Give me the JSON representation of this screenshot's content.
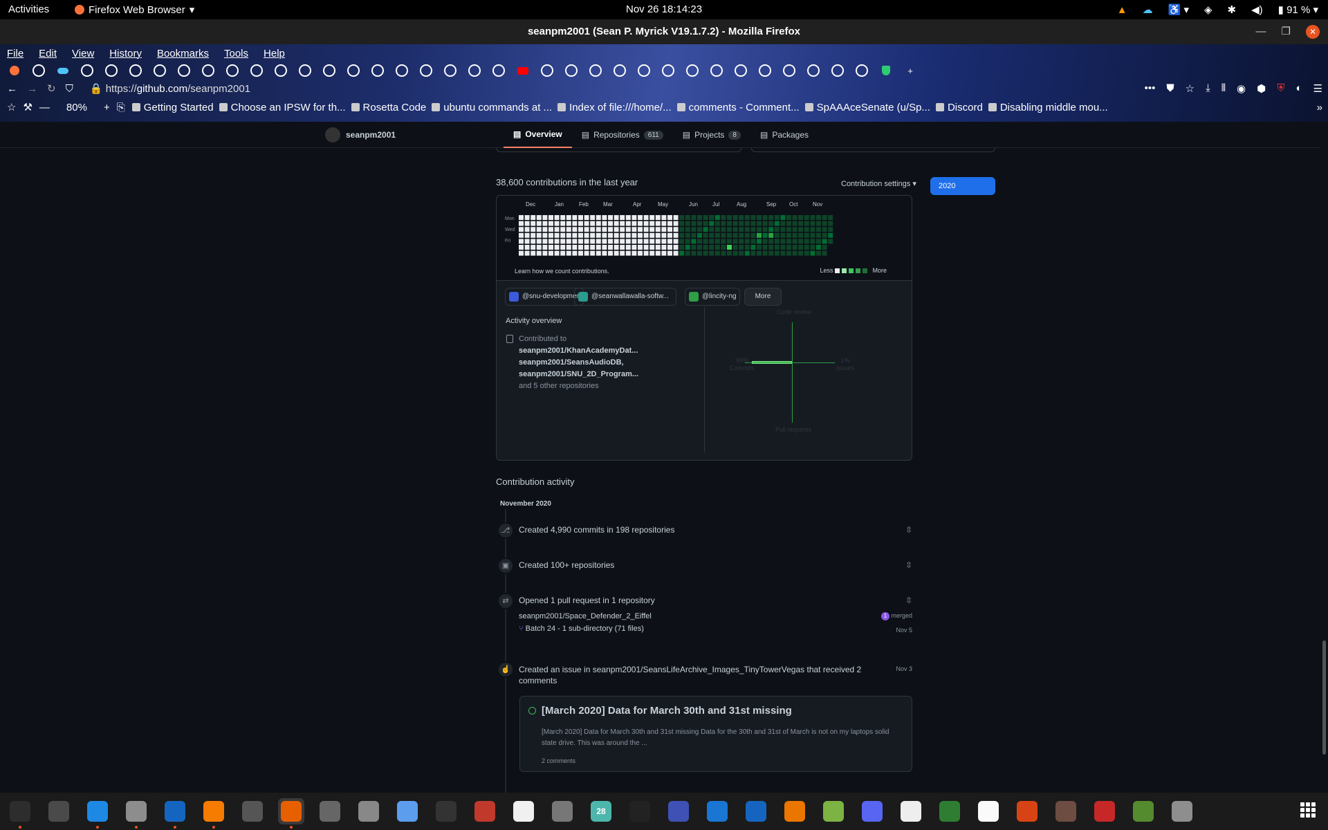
{
  "system": {
    "activities": "Activities",
    "app_name": "Firefox Web Browser",
    "clock": "Nov 26  18:14:23",
    "battery": "91 %"
  },
  "window": {
    "title": "seanpm2001 (Sean P. Myrick V19.1.7.2) - Mozilla Firefox"
  },
  "menu": [
    "File",
    "Edit",
    "View",
    "History",
    "Bookmarks",
    "Tools",
    "Help"
  ],
  "tabs": [
    "ff",
    "gh",
    "cloud",
    "gh",
    "gh",
    "gh",
    "gh",
    "gh",
    "gh",
    "gh",
    "gh",
    "gh",
    "gh",
    "gh",
    "gh",
    "gh",
    "gh",
    "gh",
    "gh",
    "gh",
    "gh",
    "yt",
    "gh",
    "gh",
    "gh",
    "gh",
    "gh",
    "gh",
    "gh",
    "gh",
    "gh",
    "gh",
    "gh",
    "gh",
    "gh",
    "gh",
    "vpn"
  ],
  "url": {
    "prefix": "https://",
    "domain": "github.com",
    "path": "/seanpm2001"
  },
  "zoom": "80%",
  "bookmarks": [
    "Getting Started",
    "Choose an IPSW for th...",
    "Rosetta Code",
    "ubuntu commands at ...",
    "Index of file:///home/...",
    "comments - Comment...",
    "SpAAAceSenate (u/Sp...",
    "Discord",
    "Disabling middle mou..."
  ],
  "profile": {
    "username": "seanpm2001",
    "tabs": [
      {
        "label": "Overview",
        "count": ""
      },
      {
        "label": "Repositories",
        "count": "611"
      },
      {
        "label": "Projects",
        "count": "8"
      },
      {
        "label": "Packages",
        "count": ""
      }
    ]
  },
  "contributions": {
    "heading": "38,600 contributions in the last year",
    "settings": "Contribution settings ▾",
    "year": "2020",
    "months": [
      "Dec",
      "Jan",
      "Feb",
      "Mar",
      "Apr",
      "May",
      "Jun",
      "Jul",
      "Aug",
      "Sep",
      "Oct",
      "Nov"
    ],
    "days": [
      "Mon",
      "Wed",
      "Fri"
    ],
    "learn": "Learn how we count contributions.",
    "less": "Less",
    "more": "More",
    "colors": {
      "empty": "#ebedf0",
      "l1": "#0e4429",
      "l2": "#006d32",
      "l3": "#26a641",
      "l4": "#39d353"
    }
  },
  "orgs": [
    "@snu-development",
    "@seanwallawalla-softw...",
    "@lincity-ng",
    "More"
  ],
  "activity": {
    "title": "Activity overview",
    "contributed_to": "Contributed to",
    "repos": [
      "seanpm2001/KhanAcademyDat...",
      "seanpm2001/SeansAudioDB,",
      "seanpm2001/SNU_2D_Program..."
    ],
    "others": "and 5 other repositories",
    "axes": {
      "code_review": "Code review",
      "commits_pct": "99%",
      "commits": "Commits",
      "issues_pct": "1%",
      "issues": "Issues",
      "pull_requests": "Pull requests"
    }
  },
  "feed": {
    "heading": "Contribution activity",
    "month": "November 2020",
    "items": [
      {
        "text": "Created 4,990 commits in 198 repositories"
      },
      {
        "text": "Created 100+ repositories"
      },
      {
        "text": "Opened 1 pull request in 1 repository"
      }
    ],
    "pr": {
      "repo": "seanpm2001/Space_Defender_2_Eiffel",
      "status": "merged",
      "status_count": "1",
      "branch": "Batch 24 - 1 sub-directory (71 files)",
      "date": "Nov 5"
    },
    "issue_event": {
      "prefix": "Created an issue in",
      "repo": "seanpm2001/SeansLifeArchive_Images_TinyTowerVegas",
      "suffix": "that received 2",
      "suffix2": "comments",
      "date": "Nov 3"
    },
    "issue": {
      "title": "[March 2020] Data for March 30th and 31st missing",
      "body": "[March 2020] Data for March 30th and 31st missing Data for the 30th and 31st of March is not on my laptops solid state drive. This was around the ...",
      "comments": "2 comments"
    }
  },
  "dock": [
    "monitor",
    "puzzle",
    "writer",
    "files",
    "text-editor",
    "vlc",
    "calculator",
    "firefox",
    "settings",
    "magnifier",
    "bookmark",
    "terminal",
    "aptik",
    "wave",
    "software",
    "28",
    "inkscape",
    "tasks",
    "screenshot",
    "virtualbox",
    "blender",
    "image-viewer",
    "discord",
    "unknown",
    "calc",
    "typora",
    "impress",
    "gimp",
    "mario",
    "minecraft",
    "maps"
  ]
}
